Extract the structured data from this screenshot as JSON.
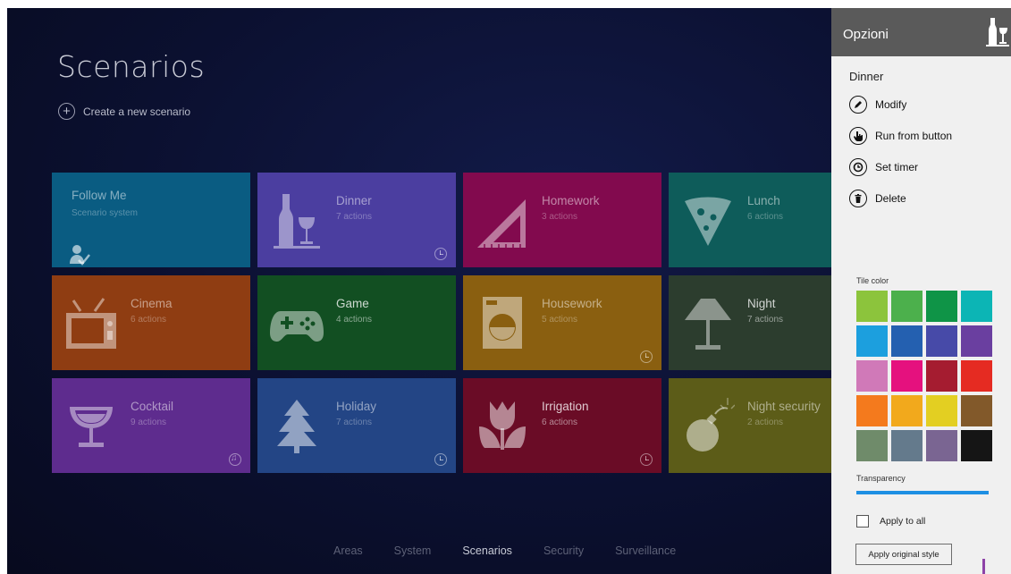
{
  "page": {
    "title": "Scenarios",
    "create_label": "Create a new scenario"
  },
  "tiles": [
    {
      "name": "Follow Me",
      "subtitle": "Scenario system",
      "icon": "person-check-icon",
      "color": "#0a5c82",
      "badge": ""
    },
    {
      "name": "Dinner",
      "subtitle": "7 actions",
      "icon": "wine-bottle-glass-icon",
      "color": "#4b3ea0",
      "badge": "clock-icon"
    },
    {
      "name": "Homework",
      "subtitle": "3 actions",
      "icon": "set-square-icon",
      "color": "#820a4e",
      "badge": ""
    },
    {
      "name": "Lunch",
      "subtitle": "6 actions",
      "icon": "pizza-slice-icon",
      "color": "#0e5c5a",
      "badge": ""
    },
    {
      "name": "Cinema",
      "subtitle": "6 actions",
      "icon": "tv-icon",
      "color": "#8f3d12",
      "badge": ""
    },
    {
      "name": "Game",
      "subtitle": "4 actions",
      "icon": "gamepad-icon",
      "color": "#124f22",
      "badge": ""
    },
    {
      "name": "Housework",
      "subtitle": "5 actions",
      "icon": "washing-machine-icon",
      "color": "#8a5f10",
      "badge": "clock-icon"
    },
    {
      "name": "Night",
      "subtitle": "7 actions",
      "icon": "lamp-icon",
      "color": "#2c3d2e",
      "badge": "clock-icon"
    },
    {
      "name": "Cocktail",
      "subtitle": "9 actions",
      "icon": "cocktail-glass-icon",
      "color": "#5e2c8e",
      "badge": "music-icon"
    },
    {
      "name": "Holiday",
      "subtitle": "7 actions",
      "icon": "tree-icon",
      "color": "#234585",
      "badge": "clock-icon"
    },
    {
      "name": "Irrigation",
      "subtitle": "6 actions",
      "icon": "tulip-icon",
      "color": "#6a0c26",
      "badge": "clock-icon"
    },
    {
      "name": "Night security",
      "subtitle": "2 actions",
      "icon": "bomb-icon",
      "color": "#5c5c18",
      "badge": ""
    }
  ],
  "bottom_nav": [
    {
      "label": "Areas",
      "active": false
    },
    {
      "label": "System",
      "active": false
    },
    {
      "label": "Scenarios",
      "active": true
    },
    {
      "label": "Security",
      "active": false
    },
    {
      "label": "Surveillance",
      "active": false
    }
  ],
  "options": {
    "title": "Opzioni",
    "logo_icon": "wine-bottle-glass-icon",
    "selected_scenario": "Dinner",
    "actions": [
      {
        "label": "Modify",
        "icon": "pencil-icon"
      },
      {
        "label": "Run from button",
        "icon": "hand-pointer-icon"
      },
      {
        "label": "Set timer",
        "icon": "clock-icon"
      },
      {
        "label": "Delete",
        "icon": "trash-icon"
      }
    ],
    "tile_color_label": "Tile color",
    "swatches": [
      "#8cc43c",
      "#4cb04c",
      "#0f9447",
      "#0cb5b5",
      "#1c9fde",
      "#2460b0",
      "#474aa8",
      "#6a3fa0",
      "#d079b8",
      "#e5117e",
      "#a51c30",
      "#e52b22",
      "#f47a1d",
      "#f2a91c",
      "#e3cf22",
      "#82592a",
      "#6f8b6a",
      "#647a8c",
      "#7a6592",
      "#151515"
    ],
    "transparency_label": "Transparency",
    "transparency_value": 1.0,
    "apply_all_label": "Apply to all",
    "apply_all_checked": false,
    "apply_original_label": "Apply original style"
  }
}
